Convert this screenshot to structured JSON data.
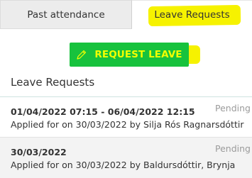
{
  "tabs": {
    "past_attendance": "Past attendance",
    "leave_requests": "Leave Requests"
  },
  "request_button": {
    "label": "REQUEST LEAVE",
    "icon": "pencil-icon"
  },
  "section": {
    "title": "Leave Requests"
  },
  "requests": [
    {
      "dates": "01/04/2022 07:15 - 06/04/2022 12:15",
      "applied": "Applied for on 30/03/2022 by Silja Rós Ragnarsdóttir",
      "status": "Pending"
    },
    {
      "dates": "30/03/2022",
      "applied": "Applied for on 30/03/2022 by Baldursdóttir, Brynja",
      "status": "Pending"
    }
  ],
  "colors": {
    "button_bg": "#17c23d",
    "button_text": "#f3ff00",
    "highlight": "#f6f200"
  }
}
